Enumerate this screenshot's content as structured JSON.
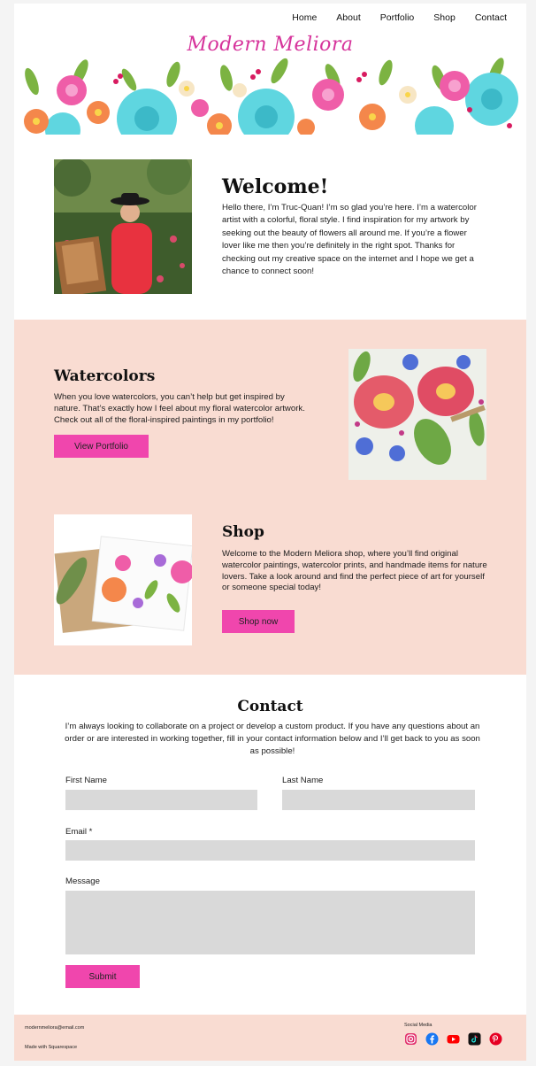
{
  "nav": {
    "items": [
      {
        "label": "Home"
      },
      {
        "label": "About"
      },
      {
        "label": "Portfolio"
      },
      {
        "label": "Shop"
      },
      {
        "label": "Contact"
      }
    ]
  },
  "brand": {
    "logo_text": "Modern Meliora"
  },
  "welcome": {
    "title": "Welcome!",
    "text": "Hello there, I’m Truc-Quan! I’m so glad you’re here. I’m a watercolor artist with a colorful, floral style. I find inspiration for my artwork by seeking out the beauty of flowers all around me. If you’re a flower lover like me then you’re definitely in the right spot. Thanks for checking out my creative space on the internet and I hope we get a chance to connect soon!"
  },
  "watercolors": {
    "title": "Watercolors",
    "text": "When you love watercolors, you can’t help but get inspired by nature. That’s exactly how I feel about my floral watercolor artwork. Check out all of the floral-inspired paintings in my portfolio!",
    "button": "View Portfolio"
  },
  "shop": {
    "title": "Shop",
    "text": "Welcome to the Modern Meliora shop, where you’ll find original watercolor paintings, watercolor prints, and handmade items for nature lovers. Take a look around and find the perfect piece of art for yourself or someone special today!",
    "button": "Shop now"
  },
  "contact": {
    "title": "Contact",
    "text": "I’m always looking to collaborate on a project or develop a custom product. If you have any questions about an order or are interested in working together, fill in your contact information below and I’ll get back to you as soon as possible!",
    "first_name_label": "First Name",
    "last_name_label": "Last Name",
    "email_label": "Email *",
    "message_label": "Message",
    "submit": "Submit"
  },
  "footer": {
    "email": "modernmeliora@email.com",
    "made_with": "Made with Squarespace",
    "social_label": "Social Media",
    "social_icons": [
      "instagram-icon",
      "facebook-icon",
      "youtube-icon",
      "tiktok-icon",
      "pinterest-icon"
    ]
  },
  "colors": {
    "accent": "#f046ad",
    "section_bg": "#f9dcd2",
    "field_bg": "#d9d9d9",
    "logo": "#d6339b"
  }
}
